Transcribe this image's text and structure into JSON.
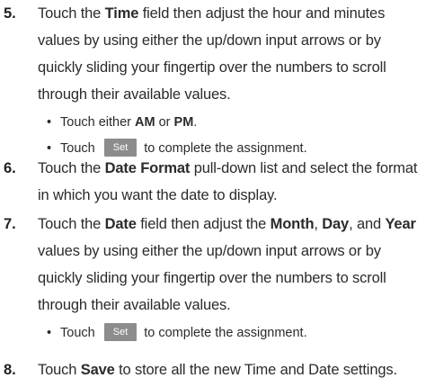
{
  "steps": [
    {
      "number": "5.",
      "lines": [
        {
          "parts": [
            {
              "t": "Touch the ",
              "b": false
            },
            {
              "t": "Time",
              "b": true
            },
            {
              "t": " field then adjust the hour and minutes",
              "b": false
            }
          ]
        },
        {
          "parts": [
            {
              "t": "values by using either the up/down input arrows or by",
              "b": false
            }
          ]
        },
        {
          "parts": [
            {
              "t": "quickly sliding your fingertip over the numbers to scroll",
              "b": false
            }
          ]
        },
        {
          "parts": [
            {
              "t": "through their available values.",
              "b": false
            }
          ]
        }
      ],
      "bullets": [
        {
          "parts": [
            {
              "t": "Touch either ",
              "b": false
            },
            {
              "t": "AM",
              "b": true
            },
            {
              "t": " or ",
              "b": false
            },
            {
              "t": "PM",
              "b": true
            },
            {
              "t": ".",
              "b": false
            }
          ]
        },
        {
          "parts": [
            {
              "t": "Touch ",
              "b": false
            },
            {
              "t": "Set",
              "btn": true
            },
            {
              "t": "to complete the assignment.",
              "b": false
            }
          ]
        }
      ]
    },
    {
      "number": "6.",
      "lines": [
        {
          "parts": [
            {
              "t": "Touch the ",
              "b": false
            },
            {
              "t": "Date Format",
              "b": true
            },
            {
              "t": " pull-down list and select the format",
              "b": false
            }
          ]
        },
        {
          "parts": [
            {
              "t": "in which you want the date to display.",
              "b": false
            }
          ]
        }
      ],
      "bullets": []
    },
    {
      "number": "7.",
      "lines": [
        {
          "parts": [
            {
              "t": "Touch the ",
              "b": false
            },
            {
              "t": "Date",
              "b": true
            },
            {
              "t": " field then adjust the ",
              "b": false
            },
            {
              "t": "Month",
              "b": true
            },
            {
              "t": ", ",
              "b": false
            },
            {
              "t": "Day",
              "b": true
            },
            {
              "t": ", and ",
              "b": false
            },
            {
              "t": "Year",
              "b": true
            }
          ]
        },
        {
          "parts": [
            {
              "t": "values by using either the up/down input arrows or by",
              "b": false
            }
          ]
        },
        {
          "parts": [
            {
              "t": "quickly sliding your fingertip over the numbers to scroll",
              "b": false
            }
          ]
        },
        {
          "parts": [
            {
              "t": "through their available values.",
              "b": false
            }
          ]
        }
      ],
      "bullets": [
        {
          "parts": [
            {
              "t": "Touch ",
              "b": false
            },
            {
              "t": "Set",
              "btn": true
            },
            {
              "t": "to complete the assignment.",
              "b": false
            }
          ]
        }
      ]
    },
    {
      "number": "8.",
      "lines": [
        {
          "parts": [
            {
              "t": "Touch ",
              "b": false
            },
            {
              "t": "Save",
              "b": true
            },
            {
              "t": " to store all the new Time and Date settings.",
              "b": false
            }
          ]
        }
      ],
      "bullets": []
    }
  ],
  "colors": {
    "text": "#2b2b2b",
    "set_button_bg": "#8c8c8c",
    "set_button_text": "#ffffff"
  }
}
